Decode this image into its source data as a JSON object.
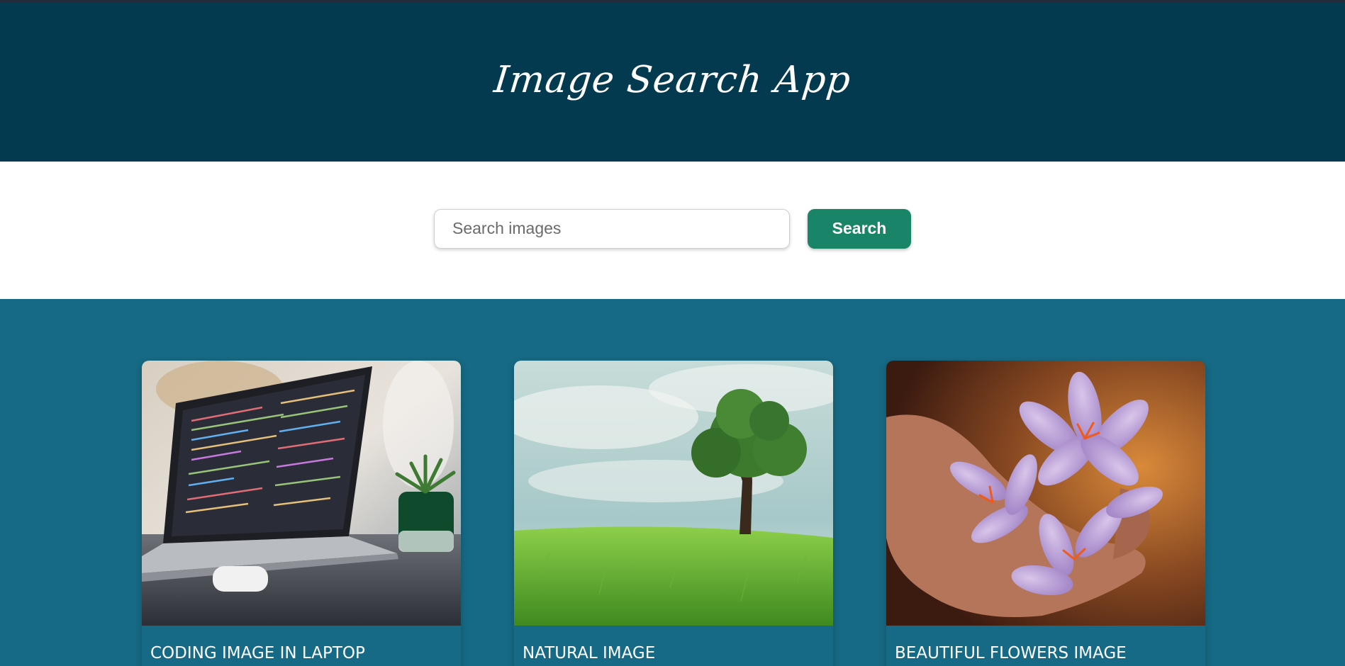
{
  "header": {
    "title": "Image Search App"
  },
  "search": {
    "placeholder": "Search images",
    "value": "",
    "button_label": "Search"
  },
  "results": [
    {
      "title": "CODING IMAGE IN LAPTOP",
      "image": "laptop-with-code-and-plant"
    },
    {
      "title": "NATURAL IMAGE",
      "image": "tree-in-green-field"
    },
    {
      "title": "BEAUTIFUL FLOWERS IMAGE",
      "image": "purple-crocus-flowers-in-hand"
    }
  ],
  "colors": {
    "header_bg": "#033a50",
    "results_bg": "#176a85",
    "button_bg": "#198467",
    "text_light": "#ffffff"
  }
}
